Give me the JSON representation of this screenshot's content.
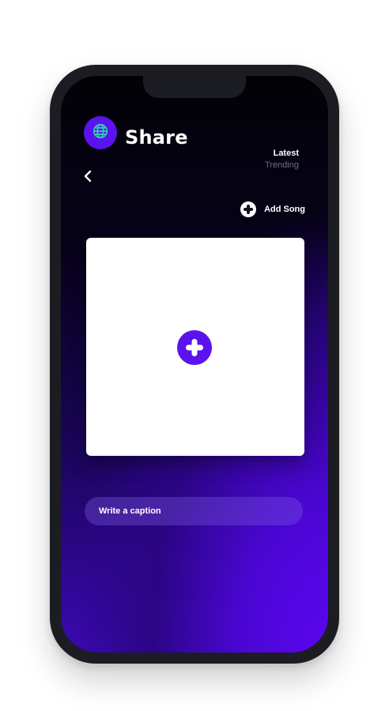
{
  "header": {
    "title": "Share",
    "globe_icon": "globe-icon",
    "back_icon": "chevron-left-icon"
  },
  "tabs": {
    "latest": "Latest",
    "trending": "Trending"
  },
  "add_song": {
    "label": "Add Song",
    "icon": "plus-circle-icon"
  },
  "upload": {
    "icon": "plus-circle-icon"
  },
  "caption": {
    "placeholder": "Write a caption",
    "value": ""
  },
  "colors": {
    "accent": "#5b13ee",
    "globe_stroke": "#2ed1b8",
    "frame": "#1c1d23",
    "trending_text": "#6f6f86"
  }
}
